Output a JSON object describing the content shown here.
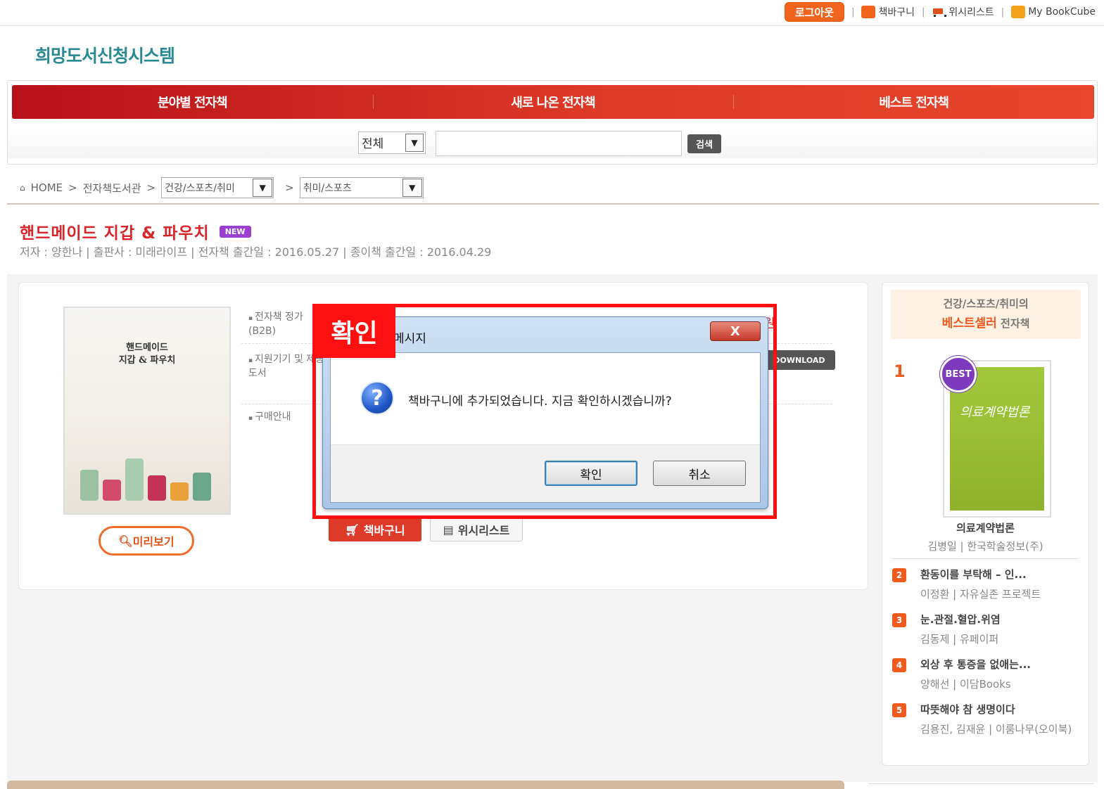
{
  "util": {
    "logout": "로그아웃",
    "cart": "책바구니",
    "wishlist": "위시리스트",
    "mybookcube": "My BookCube",
    "separator": "|"
  },
  "logo": "희망도서신청시스템",
  "nav": {
    "items": [
      "분야별 전자책",
      "새로 나온 전자책",
      "베스트 전자책"
    ]
  },
  "search": {
    "category": "전체",
    "button": "검색",
    "arrow": "▼"
  },
  "breadcrumb": {
    "home": "HOME",
    "sep": ">",
    "library": "전자책도서관",
    "cat1": "건강/스포츠/취미",
    "cat2": "취미/스포츠"
  },
  "book": {
    "title": "핸드메이드 지갑 & 파우치",
    "badge": "NEW",
    "meta": "저자 : 양한나 | 출판사 : 미래라이프 | 전자책 출간일 : 2016.05.27 | 종이책 출간일 : 2016.04.29",
    "cover_title_line1": "핸드메이드",
    "cover_title_line2": "지갑 & 파우치",
    "preview": "미리보기",
    "label_price": "전자책 정가 (B2B)",
    "label_device": "지원기기 및 제공도서",
    "label_purchase": "구매안내",
    "price_peek": "원",
    "download": "DOWNLOAD",
    "cart_button": "책바구니",
    "wish_button": "위시리스트"
  },
  "sidebar": {
    "head_line1": "건강/스포츠/취미의",
    "head_hl": "베스트셀러",
    "head_suffix": "전자책",
    "first": {
      "rank": "1",
      "badge": "BEST",
      "cover_title": "의료계약법론",
      "title": "의료계약법론",
      "meta": "김병일 | 한국학술정보(주)"
    },
    "items": [
      {
        "rank": "2",
        "title": "환동이를 부탁해 – 인...",
        "meta": "이정환 | 자유실존 프로젝트"
      },
      {
        "rank": "3",
        "title": "눈.관절.혈압.위염",
        "meta": "김동제 | 유페이퍼"
      },
      {
        "rank": "4",
        "title": "외상 후 통증을 없애는...",
        "meta": "양해선 | 이담Books"
      },
      {
        "rank": "5",
        "title": "따뜻해야 참 생명이다",
        "meta": "김용진, 김재윤 | 이룸나무(오이북)"
      }
    ]
  },
  "callout": "확인",
  "dialog": {
    "title": "메시지",
    "close": "X",
    "message": "책바구니에 추가되었습니다. 지금 확인하시겠습니까?",
    "ok": "확인",
    "cancel": "취소"
  },
  "colors": {
    "accent": "#f05a1e",
    "nav_red": "#d0241e",
    "highlight": "#ff1010",
    "logo": "#2a8a93"
  }
}
